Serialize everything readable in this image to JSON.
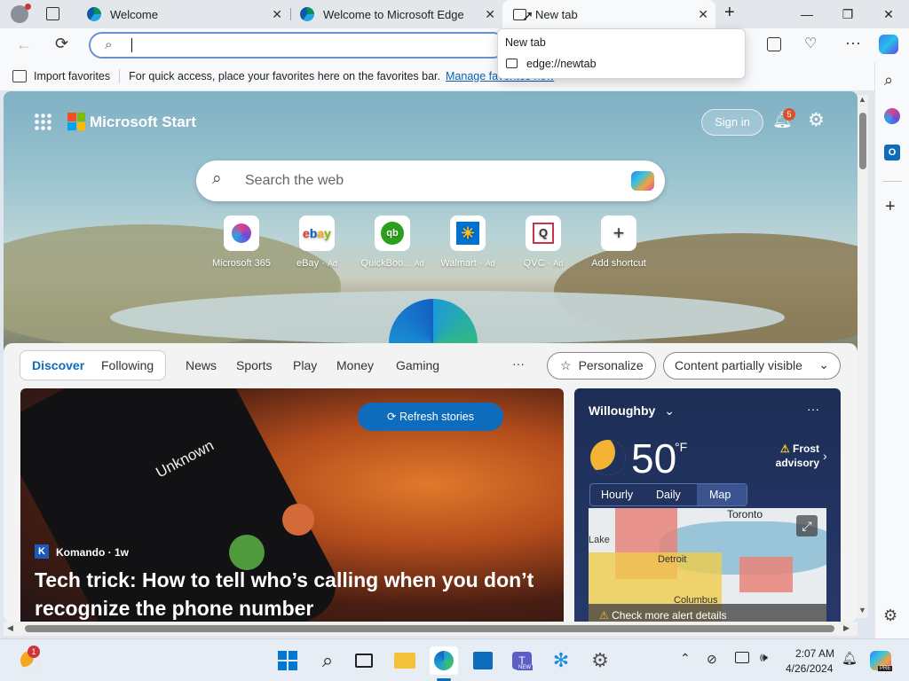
{
  "tabs": [
    {
      "label": "Welcome"
    },
    {
      "label": "Welcome to Microsoft Edge"
    },
    {
      "label": "New tab"
    }
  ],
  "address": {
    "value": ""
  },
  "favorites_bar": {
    "import_label": "Import favorites",
    "hint": "For quick access, place your favorites here on the favorites bar.",
    "manage_link": "Manage favorites now"
  },
  "popup": {
    "title": "New tab",
    "url": "edge://newtab"
  },
  "start": {
    "brand": "Microsoft Start",
    "sign_in": "Sign in",
    "notification_count": "5",
    "search_placeholder": "Search the web",
    "tiles": [
      {
        "label": "Microsoft 365",
        "ad": ""
      },
      {
        "label": "eBay",
        "ad": "Ad"
      },
      {
        "label": "QuickBoo...",
        "ad": "Ad"
      },
      {
        "label": "Walmart",
        "ad": "Ad"
      },
      {
        "label": "QVC",
        "ad": "Ad"
      },
      {
        "label": "Add shortcut",
        "ad": ""
      }
    ]
  },
  "feed_nav": {
    "discover": "Discover",
    "following": "Following",
    "items": [
      "News",
      "Sports",
      "Play",
      "Money",
      "Gaming"
    ],
    "more": "···",
    "personalize": "Personalize",
    "content_visibility": "Content partially visible"
  },
  "story": {
    "refresh": "Refresh stories",
    "phone_text": "Unknown",
    "source_badge": "K",
    "source": "Komando · 1w",
    "headline": "Tech trick: How to tell who’s calling when you don’t recognize the phone number"
  },
  "weather": {
    "location": "Willoughby",
    "temp": "50",
    "unit": "°F",
    "alert_line1": "Frost",
    "alert_line2": "advisory",
    "tabs": [
      "Hourly",
      "Daily",
      "Map"
    ],
    "map_labels": {
      "toronto": "Toronto",
      "detroit": "Detroit",
      "lake": "Lake",
      "columbus": "Columbus"
    },
    "alert_details": "Check more alert details"
  },
  "taskbar": {
    "time": "2:07 AM",
    "date": "4/26/2024",
    "weather_badge": "1",
    "teams_badge": "NEW",
    "copilot_badge": "PRE"
  }
}
